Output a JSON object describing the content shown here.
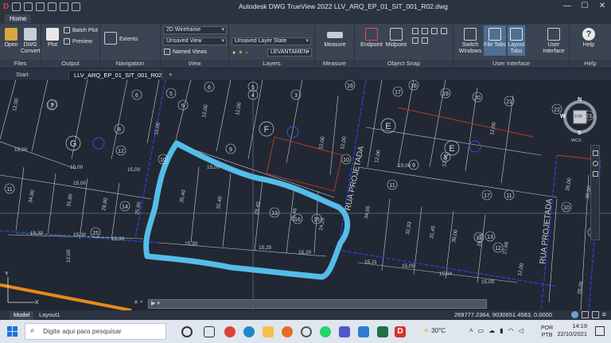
{
  "window": {
    "title": "Autodesk DWG TrueView 2022    LLV_ARQ_EP_01_SIT_001_R02.dwg",
    "min": "—",
    "max": "☐",
    "close": "✕"
  },
  "ribbon": {
    "tab_home": "Home",
    "panels": {
      "files": {
        "label": "Files",
        "open": "Open",
        "dwg_convert": "DWG Convert"
      },
      "output": {
        "label": "Output",
        "plot": "Plot",
        "batch_plot": "Batch Plot",
        "preview": "Preview"
      },
      "navigation": {
        "label": "Navigation",
        "extents": "Extents"
      },
      "view": {
        "label": "View",
        "visual_style": "2D Wireframe",
        "unsaved_view": "Unsaved View",
        "named_views": "Named Views"
      },
      "layers": {
        "label": "Layers",
        "layer_state": "Unsaved Layer State",
        "current_layer": "LEVANTAMEN"
      },
      "measure": {
        "label": "Measure",
        "measure": "Measure"
      },
      "object_snap": {
        "label": "Object Snap",
        "endpoint": "Endpoint",
        "midpoint": "Midpoint"
      },
      "user_interface": {
        "label": "User Interface",
        "switch_windows": "Switch Windows",
        "file_tabs": "File Tabs",
        "layout_tabs": "Layout Tabs",
        "user_interface": "User Interface"
      },
      "help": {
        "label": "Help",
        "help": "Help"
      }
    }
  },
  "doc_tabs": {
    "start": "Start",
    "active": "LLV_ARQ_EP_01_SIT_001_R02",
    "close": "✕",
    "add": "+"
  },
  "viewcube": {
    "n": "N",
    "s": "S",
    "w": "W",
    "top": "TOP",
    "wcs": "WCS"
  },
  "drawing": {
    "street_1": "RUA PROJETADA",
    "street_2": "RUA PROJETADA",
    "lot_numbers": [
      "7",
      "6",
      "4",
      "3",
      "9",
      "9",
      "8",
      "12",
      "10",
      "11",
      "13",
      "14",
      "15",
      "16",
      "15",
      "16",
      "17",
      "18",
      "19",
      "20",
      "21",
      "22",
      "23",
      "11",
      "11",
      "12",
      "12",
      "13",
      "10",
      "9",
      "8",
      "10",
      "20",
      "17",
      "5",
      "6",
      "6",
      "5"
    ],
    "block_letters": [
      "G",
      "F",
      "E",
      "E"
    ],
    "dimensions": [
      "15,00",
      "15,00",
      "15,00",
      "15,00",
      "15,00",
      "15,30",
      "15,30",
      "15,30",
      "15,30",
      "15,25",
      "15,20",
      "15,11",
      "15,05",
      "15,04",
      "15,00",
      "15,00",
      "12,00",
      "12,00",
      "12,00",
      "12,00",
      "12,00",
      "12,00",
      "12,00",
      "12,00",
      "34,80",
      "31,80",
      "28,80",
      "25,80",
      "35,40",
      "32,40",
      "29,40",
      "26,46",
      "24,29",
      "34,65",
      "32,93",
      "31,45",
      "30,00",
      "28,74",
      "27,66",
      "26,00",
      "30,00",
      "20,00",
      "12,00",
      "12,00",
      "12,00"
    ]
  },
  "command_line": {
    "prompt": "▶ ▾"
  },
  "layout_tabs": {
    "model": "Model",
    "layout1": "Layout1"
  },
  "status": {
    "coordinates": "269777.2364, 9030651.4583, 0.0000"
  },
  "taskbar": {
    "search_placeholder": "Digite aqui para pesquisar",
    "weather": "30°C",
    "lang_1": "POR",
    "lang_2": "PTB",
    "time": "14:19",
    "date": "22/10/2021"
  },
  "colors": {
    "canvas_bg": "#212833",
    "highlight_outline": "#55bde8",
    "orange_line": "#e88a1a",
    "blue_dashed": "#2d3ec9",
    "red_line": "#c0392b"
  }
}
